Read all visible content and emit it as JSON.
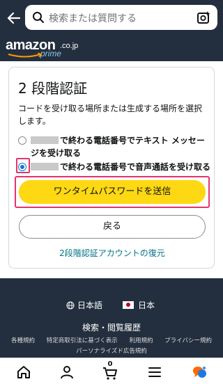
{
  "search": {
    "placeholder": "検索または質問する"
  },
  "brand": {
    "main": "amazon",
    "domain": ".co.jp",
    "tier": "prime"
  },
  "card": {
    "title": "2 段階認証",
    "description": "コードを受け取る場所または生成する場所を選択します。",
    "options": [
      {
        "label": "で終わる電話番号でテキスト メッセージを受け取る",
        "selected": false
      },
      {
        "label": "で終わる電話番号で音声通話を受け取る",
        "selected": true
      }
    ],
    "send_button": "ワンタイムパスワードを送信",
    "back_button": "戻る",
    "recover_link": "2段階認証アカウントの復元"
  },
  "footer": {
    "language": "日本語",
    "country": "日本",
    "history": "検索・閲覧履歴",
    "links": [
      "各種規約",
      "特定商取引法に基づく表示",
      "利用規約",
      "プライバシー規約"
    ],
    "links2": "パーソナライズド広告規約"
  },
  "tabbar": {
    "cart_count": "0"
  },
  "colors": {
    "accent": "#ffd814",
    "highlight": "#e8336d",
    "link": "#007185",
    "header": "#232f3e"
  }
}
